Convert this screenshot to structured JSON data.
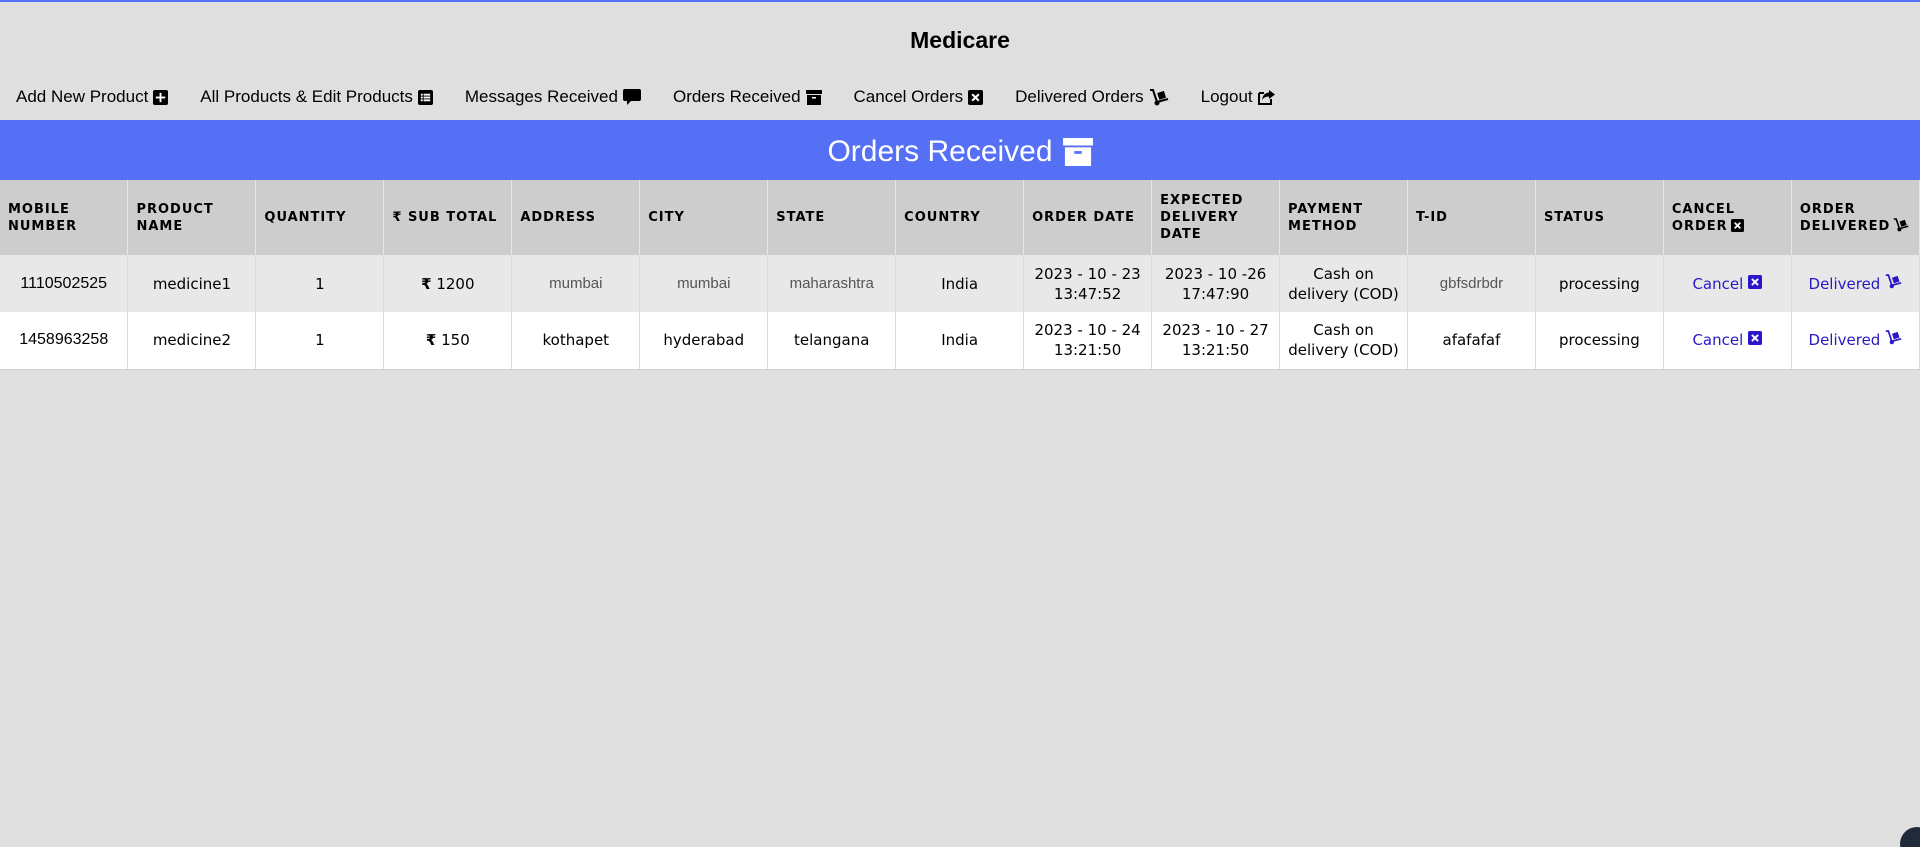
{
  "brand": "Medicare",
  "nav": [
    {
      "label": "Add New Product",
      "icon": "plus-square-icon"
    },
    {
      "label": "All Products & Edit Products",
      "icon": "list-alt-icon"
    },
    {
      "label": "Messages Received",
      "icon": "comment-icon"
    },
    {
      "label": "Orders Received",
      "icon": "archive-icon"
    },
    {
      "label": "Cancel Orders",
      "icon": "times-square-icon"
    },
    {
      "label": "Delivered Orders",
      "icon": "dolly-icon"
    },
    {
      "label": "Logout",
      "icon": "share-square-icon"
    }
  ],
  "banner": {
    "title": "Orders Received",
    "icon": "archive-icon"
  },
  "colors": {
    "accent": "#5670f5",
    "link": "#2a17c9",
    "background": "#dfdfdf",
    "header_bg": "#cdcdcd"
  },
  "table": {
    "headers": {
      "mobile": "Mobile Number",
      "product": "Product Name",
      "quantity": "Quantity",
      "subtotal": "Sub Total",
      "address": "Address",
      "city": "City",
      "state": "State",
      "country": "Country",
      "order_date": "Order Date",
      "expected": "Expected Delivery Date",
      "payment": "Payment Method",
      "tid": "T-ID",
      "status": "Status",
      "cancel": "Cancel Order",
      "delivered": "Order Delivered"
    },
    "currency": "₹",
    "rows": [
      {
        "mobile": "1110502525",
        "product": "medicine1",
        "quantity": "1",
        "subtotal": "1200",
        "address": "mumbai",
        "city": "mumbai",
        "state": "maharashtra",
        "country": "India",
        "order_date": "2023 - 10 - 23\n13:47:52",
        "expected": "2023 - 10 -26\n17:47:90",
        "payment": "Cash on\ndelivery (COD)",
        "tid": "gbfsdrbdr",
        "status": "processing",
        "cancel": "Cancel",
        "delivered": "Delivered"
      },
      {
        "mobile": "1458963258",
        "product": "medicine2",
        "quantity": "1",
        "subtotal": "150",
        "address": "kothapet",
        "city": "hyderabad",
        "state": "telangana",
        "country": "India",
        "order_date": "2023 - 10 - 24\n13:21:50",
        "expected": "2023 - 10 - 27\n13:21:50",
        "payment": "Cash on\ndelivery (COD)",
        "tid": "afafafaf",
        "status": "processing",
        "cancel": "Cancel",
        "delivered": "Delivered"
      }
    ]
  }
}
